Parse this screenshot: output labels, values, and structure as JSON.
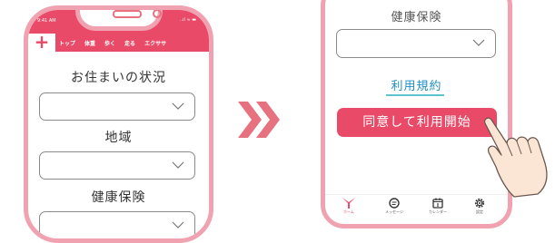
{
  "phone1": {
    "status": {
      "time": "9:41 AM",
      "icons": "..ıl ≈ ▬"
    },
    "add_symbol": "+",
    "nav": [
      "トップ",
      "体重",
      "歩く",
      "走る",
      "エクササ"
    ],
    "fields": [
      {
        "label": "お住まいの状況",
        "value": ""
      },
      {
        "label": "地域",
        "value": ""
      },
      {
        "label": "健康保険",
        "value": ""
      }
    ]
  },
  "phone2": {
    "field_label": "健康保険",
    "terms_link": "利用規約",
    "start_button": "同意して利用開始",
    "tabs": [
      {
        "label": "ホーム",
        "icon": "home-arrow-icon",
        "active": true
      },
      {
        "label": "メッセージ",
        "icon": "message-icon",
        "active": false
      },
      {
        "label": "カレンダー",
        "icon": "calendar-icon",
        "active": false
      },
      {
        "label": "設定",
        "icon": "gear-icon",
        "active": false
      }
    ]
  },
  "colors": {
    "accent": "#e84a68",
    "phone_border": "#f1a2b0",
    "link": "#1f8fc6",
    "arrow": "#e8717f"
  }
}
